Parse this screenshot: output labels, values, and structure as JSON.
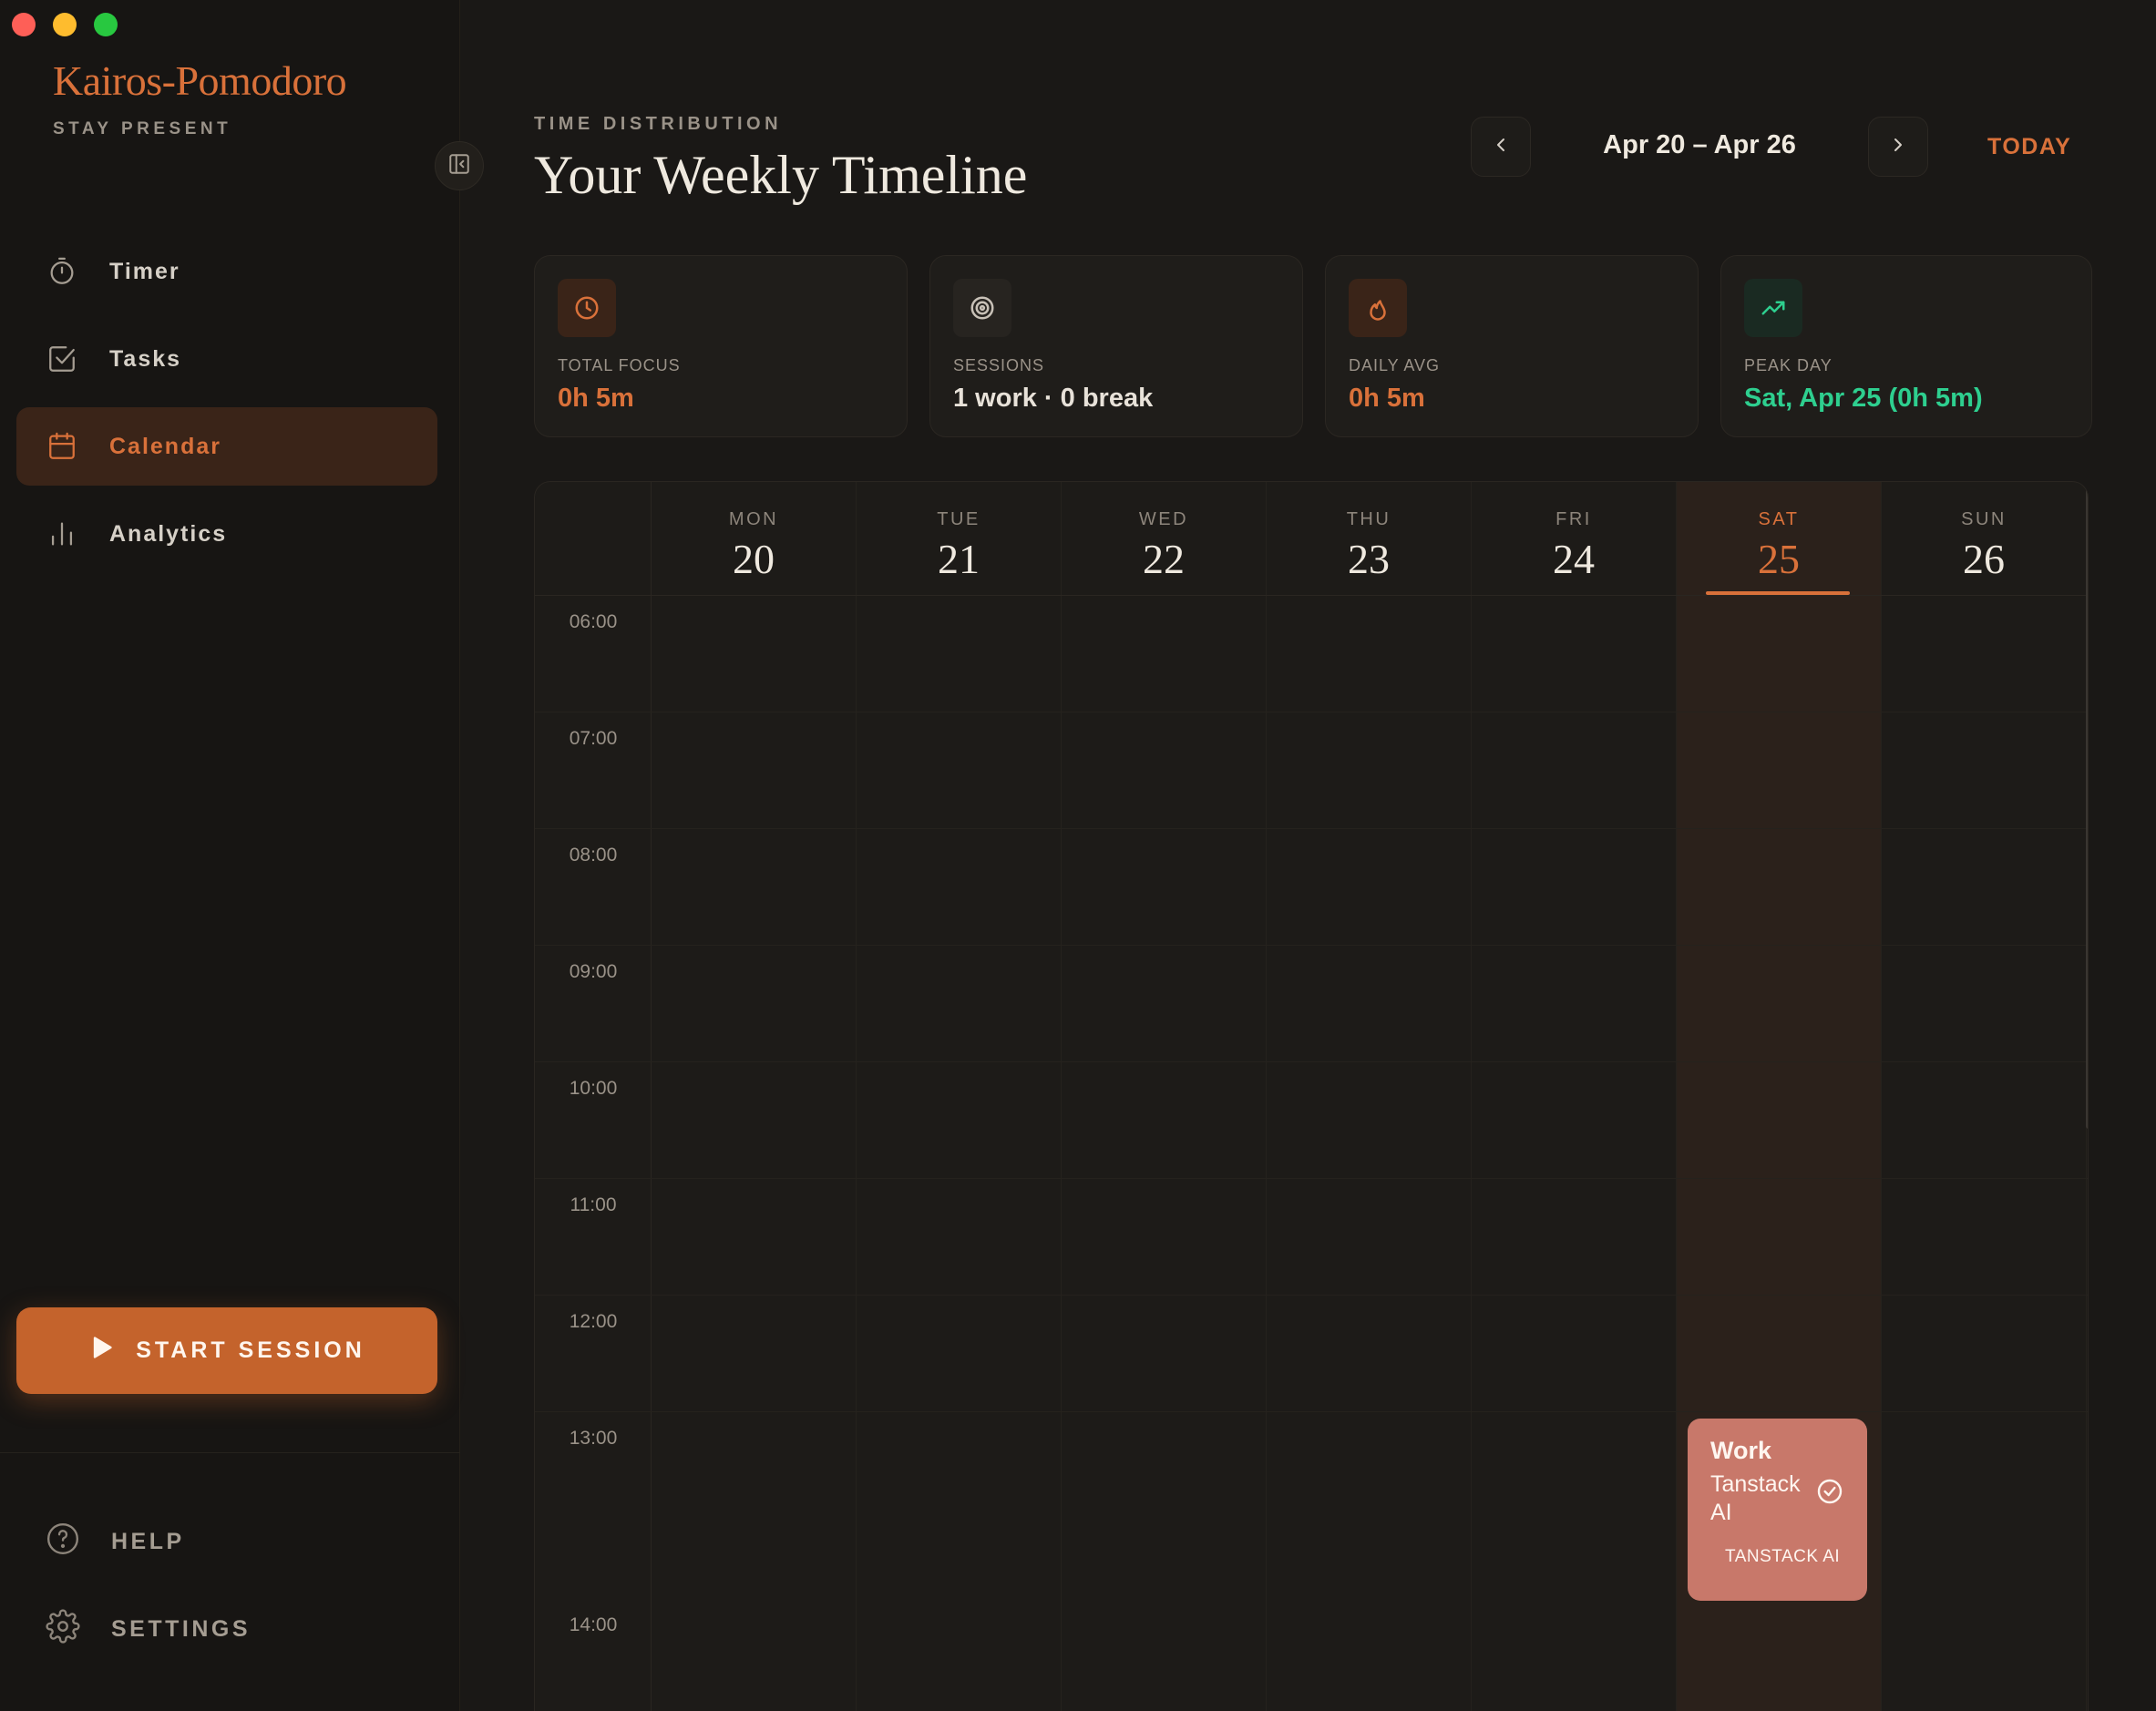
{
  "sidebar": {
    "brand": "Kairos-Pomodoro",
    "tagline": "STAY PRESENT",
    "nav": [
      {
        "label": "Timer",
        "icon": "stopwatch-icon",
        "active": false
      },
      {
        "label": "Tasks",
        "icon": "checkbox-icon",
        "active": false
      },
      {
        "label": "Calendar",
        "icon": "calendar-icon",
        "active": true
      },
      {
        "label": "Analytics",
        "icon": "bar-chart-icon",
        "active": false
      }
    ],
    "start_button": "START SESSION",
    "help": "HELP",
    "settings": "SETTINGS"
  },
  "header": {
    "eyebrow": "TIME DISTRIBUTION",
    "title": "Your Weekly Timeline",
    "range": "Apr 20 – Apr 26",
    "today": "TODAY"
  },
  "stats": [
    {
      "label": "TOTAL FOCUS",
      "value": "0h 5m",
      "icon": "clock-icon",
      "color": "#d9713a",
      "icon_bg": "#3a2418"
    },
    {
      "label": "SESSIONS",
      "value": "1 work · 0 break",
      "icon": "target-icon",
      "color": "#e8e2d9",
      "icon_bg": "#272420"
    },
    {
      "label": "DAILY AVG",
      "value": "0h 5m",
      "icon": "flame-icon",
      "color": "#d9713a",
      "icon_bg": "#3a2418"
    },
    {
      "label": "PEAK DAY",
      "value": "Sat, Apr 25 (0h 5m)",
      "icon": "trending-up-icon",
      "color": "#2ecf8f",
      "icon_bg": "#1a2a22"
    }
  ],
  "calendar": {
    "days": [
      {
        "name": "MON",
        "num": "20"
      },
      {
        "name": "TUE",
        "num": "21"
      },
      {
        "name": "WED",
        "num": "22"
      },
      {
        "name": "THU",
        "num": "23"
      },
      {
        "name": "FRI",
        "num": "24"
      },
      {
        "name": "SAT",
        "num": "25",
        "today": true
      },
      {
        "name": "SUN",
        "num": "26"
      }
    ],
    "hours": [
      "06:00",
      "07:00",
      "08:00",
      "09:00",
      "10:00",
      "11:00",
      "12:00",
      "13:00",
      "14:00"
    ],
    "event": {
      "type": "Work",
      "title": "Tanstack AI",
      "tag": "TANSTACK AI",
      "day": "SAT",
      "start": "13:05",
      "color": "#c8786a",
      "completed": true
    }
  },
  "colors": {
    "accent": "#d9713a",
    "positive": "#2ecf8f",
    "background": "#1a1816"
  }
}
